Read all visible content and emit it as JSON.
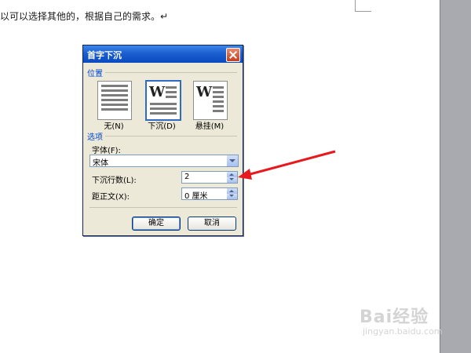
{
  "document": {
    "body_text": "以可以选择其他的，根据自己的需求。↵"
  },
  "dialog": {
    "title": "首字下沉",
    "position_section": "位置",
    "position_options": [
      {
        "label": "无(N)",
        "selected": false
      },
      {
        "label": "下沉(D)",
        "selected": true
      },
      {
        "label": "悬挂(M)",
        "selected": false
      }
    ],
    "options_section": "选项",
    "font_label": "字体(F):",
    "font_value": "宋体",
    "lines_label": "下沉行数(L):",
    "lines_value": "2",
    "distance_label": "距正文(X):",
    "distance_value": "0 厘米",
    "ok_button": "确定",
    "cancel_button": "取消"
  },
  "annotation": {
    "arrow_color": "#e8191e"
  },
  "watermark": {
    "main": "Bai经验",
    "sub": "jingyan.baidu.com"
  }
}
